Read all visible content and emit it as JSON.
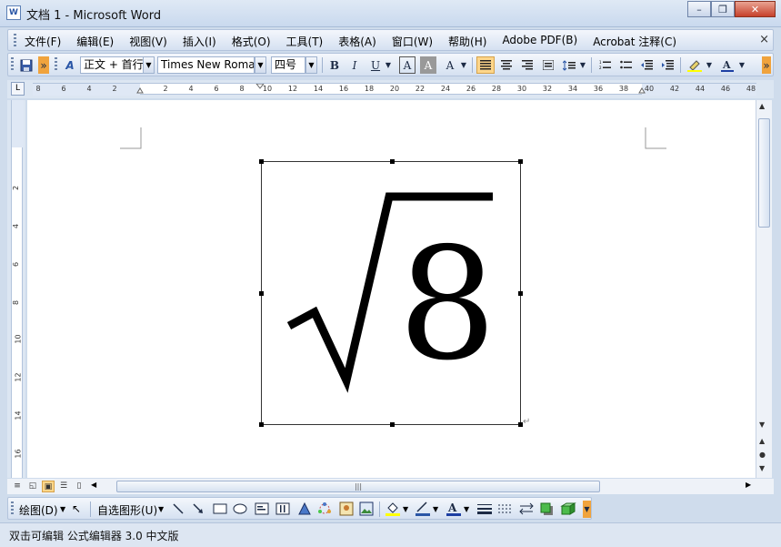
{
  "window": {
    "title": "文档 1 - Microsoft Word",
    "minimize_symbol": "–",
    "restore_symbol": "❐",
    "close_symbol": "✕"
  },
  "menu": {
    "items": [
      "文件(F)",
      "编辑(E)",
      "视图(V)",
      "插入(I)",
      "格式(O)",
      "工具(T)",
      "表格(A)",
      "窗口(W)",
      "帮助(H)",
      "Adobe PDF(B)",
      "Acrobat 注释(C)"
    ],
    "close_symbol": "×"
  },
  "toolbar": {
    "style_value": "正文 + 首行",
    "font_value": "Times New Roman",
    "size_value": "四号",
    "bold_label": "B",
    "italic_label": "I",
    "underline_label": "U",
    "char_border_label": "A",
    "char_shading_label": "A",
    "char_scale_label": "A"
  },
  "ruler": {
    "corner_symbol": "L",
    "labels": [
      "8",
      "6",
      "4",
      "2",
      "2",
      "4",
      "6",
      "8",
      "10",
      "12",
      "14",
      "16",
      "18",
      "20",
      "22",
      "24",
      "26",
      "28",
      "30",
      "32",
      "34",
      "36",
      "38",
      "40",
      "42",
      "44",
      "46",
      "48"
    ]
  },
  "vruler": {
    "labels": [
      "2",
      "4",
      "6",
      "8",
      "10",
      "12",
      "14",
      "16"
    ]
  },
  "document": {
    "equation": {
      "radical": "√",
      "radicand": "8"
    },
    "para_mark": "↵"
  },
  "hscroll": {
    "thumb_grip": "|||"
  },
  "drawing": {
    "draw_label": "绘图(D)",
    "autoshape_label": "自选图形(U)"
  },
  "status": {
    "text": "双击可编辑 公式编辑器 3.0 中文版"
  }
}
